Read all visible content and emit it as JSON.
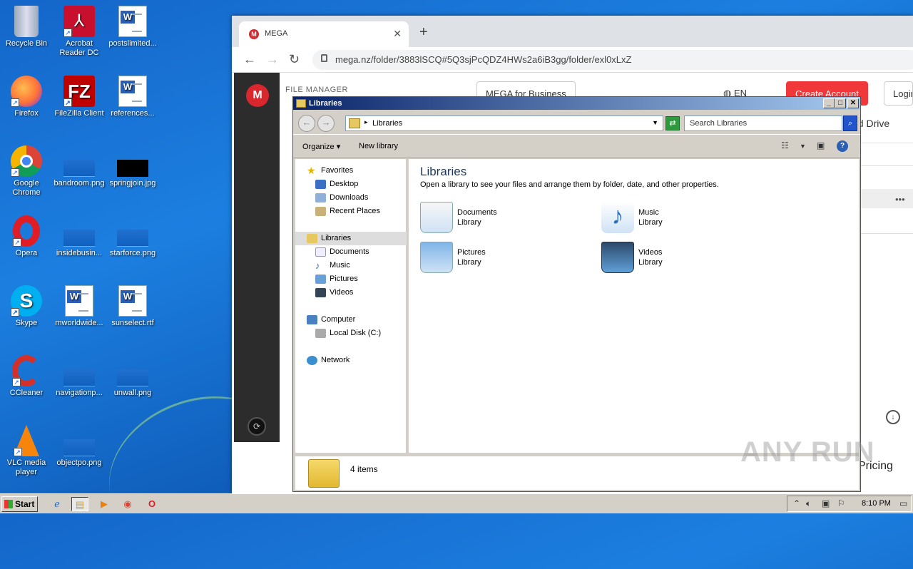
{
  "desktop": {
    "icons": [
      {
        "label": "Recycle Bin",
        "icon": "recycle-bin-icon"
      },
      {
        "label": "Acrobat Reader DC",
        "icon": "acrobat-icon"
      },
      {
        "label": "postslimited...",
        "icon": "word-doc-icon"
      },
      {
        "label": "Firefox",
        "icon": "firefox-icon"
      },
      {
        "label": "FileZilla Client",
        "icon": "filezilla-icon"
      },
      {
        "label": "references...",
        "icon": "word-doc-icon"
      },
      {
        "label": "Google Chrome",
        "icon": "chrome-icon"
      },
      {
        "label": "bandroom.png",
        "icon": "image-file-icon"
      },
      {
        "label": "springjoin.jpg",
        "icon": "image-file-icon"
      },
      {
        "label": "Opera",
        "icon": "opera-icon"
      },
      {
        "label": "insidebusin...",
        "icon": "image-file-icon"
      },
      {
        "label": "starforce.png",
        "icon": "image-file-icon"
      },
      {
        "label": "Skype",
        "icon": "skype-icon"
      },
      {
        "label": "mworldwide...",
        "icon": "word-doc-icon"
      },
      {
        "label": "sunselect.rtf",
        "icon": "word-doc-icon"
      },
      {
        "label": "CCleaner",
        "icon": "ccleaner-icon"
      },
      {
        "label": "navigationp...",
        "icon": "image-file-icon"
      },
      {
        "label": "unwall.png",
        "icon": "image-file-icon"
      },
      {
        "label": "VLC media player",
        "icon": "vlc-icon"
      },
      {
        "label": "objectpo.png",
        "icon": "image-file-icon"
      }
    ]
  },
  "browser": {
    "tab_title": "MEGA",
    "tab_favicon": "M",
    "url": "mega.nz/folder/3883lSCQ#5Q3sjPcQDZ4HWs2a6iB3gg/folder/exl0xLxZ",
    "mega": {
      "logo": "M",
      "file_manager": "FILE MANAGER",
      "business_btn": "MEGA for Business",
      "lang": "EN",
      "create_btn": "Create Account",
      "login_btn": "Login",
      "cloud_drive": "ud Drive",
      "more": "•••",
      "pricing": "Pricing"
    }
  },
  "explorer": {
    "title": "Libraries",
    "breadcrumb": "Libraries",
    "search_placeholder": "Search Libraries",
    "commands": {
      "organize": "Organize ▾",
      "new_library": "New library"
    },
    "nav": {
      "favorites": "Favorites",
      "desktop": "Desktop",
      "downloads": "Downloads",
      "recent": "Recent Places",
      "libraries": "Libraries",
      "documents": "Documents",
      "music": "Music",
      "pictures": "Pictures",
      "videos": "Videos",
      "computer": "Computer",
      "local_disk": "Local Disk (C:)",
      "network": "Network"
    },
    "content": {
      "heading": "Libraries",
      "subheading": "Open a library to see your files and arrange them by folder, date, and other properties.",
      "libraries": [
        {
          "name": "Documents",
          "type": "Library",
          "icon": "documents-library-icon"
        },
        {
          "name": "Music",
          "type": "Library",
          "icon": "music-library-icon"
        },
        {
          "name": "Pictures",
          "type": "Library",
          "icon": "pictures-library-icon"
        },
        {
          "name": "Videos",
          "type": "Library",
          "icon": "videos-library-icon"
        }
      ]
    },
    "details": "4 items"
  },
  "watermark": "ANY RUN",
  "taskbar": {
    "start": "Start",
    "clock": "8:10 PM"
  }
}
